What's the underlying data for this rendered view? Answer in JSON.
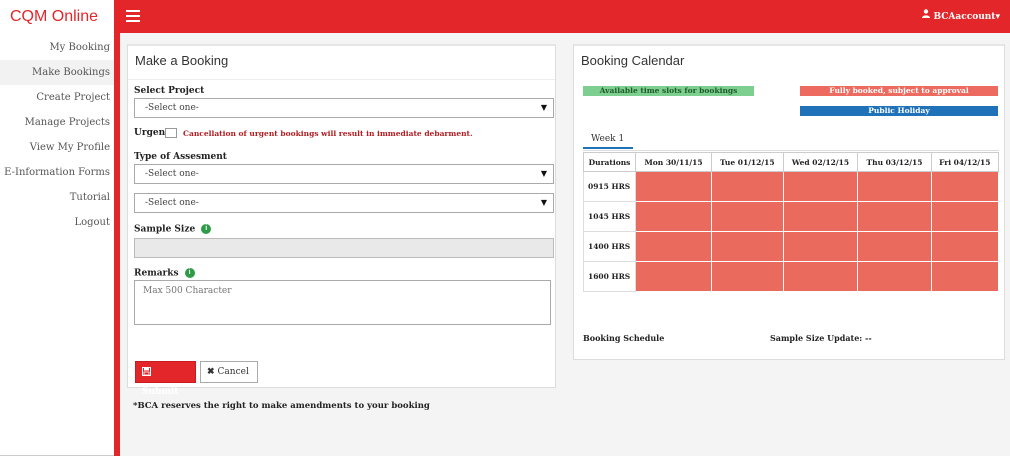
{
  "app": {
    "brand": "CQM Online"
  },
  "header": {
    "account_label": "BCAaccount"
  },
  "sidebar": {
    "items": [
      {
        "label": "My Booking"
      },
      {
        "label": "Make Bookings"
      },
      {
        "label": "Create Project"
      },
      {
        "label": "Manage Projects"
      },
      {
        "label": "View My Profile"
      },
      {
        "label": "E-Information Forms"
      },
      {
        "label": "Tutorial"
      },
      {
        "label": "Logout"
      }
    ],
    "active_index": 1
  },
  "booking": {
    "title": "Make a Booking",
    "project_label": "Select Project",
    "project_value": "-Select one-",
    "urgent_label": "Urgent",
    "urgent_note": "Cancellation of urgent bookings will result in immediate debarment.",
    "assessment_label": "Type of Assesment",
    "assessment_value": "-Select one-",
    "assessment_sub_value": "-Select one-",
    "sample_size_label": "Sample Size",
    "sample_size_value": "",
    "remarks_label": "Remarks",
    "remarks_placeholder": "Max 500 Character",
    "submit_label": "Submit",
    "cancel_label": "Cancel"
  },
  "footnote": "*BCA reserves the right to make amendments to your booking",
  "calendar": {
    "title": "Booking Calendar",
    "legend": {
      "available": "Available time slots for bookings",
      "full": "Fully booked, subject to approval",
      "holiday": "Public Holiday"
    },
    "tab_label": "Week 1",
    "header_durations": "Durations",
    "days": [
      "Mon 30/11/15",
      "Tue 01/12/15",
      "Wed 02/12/15",
      "Thu 03/12/15",
      "Fri 04/12/15"
    ],
    "times": [
      "0915 HRS",
      "1045 HRS",
      "1400 HRS",
      "1600 HRS"
    ],
    "schedule_label": "Booking Schedule",
    "sample_update_label": "Sample Size Update: --"
  },
  "colors": {
    "brand_red": "#e3262a",
    "slot_full": "#ea6a5d",
    "legend_available": "#7ccf8e",
    "legend_holiday": "#1f72b8",
    "info_green": "#2e9b47"
  }
}
